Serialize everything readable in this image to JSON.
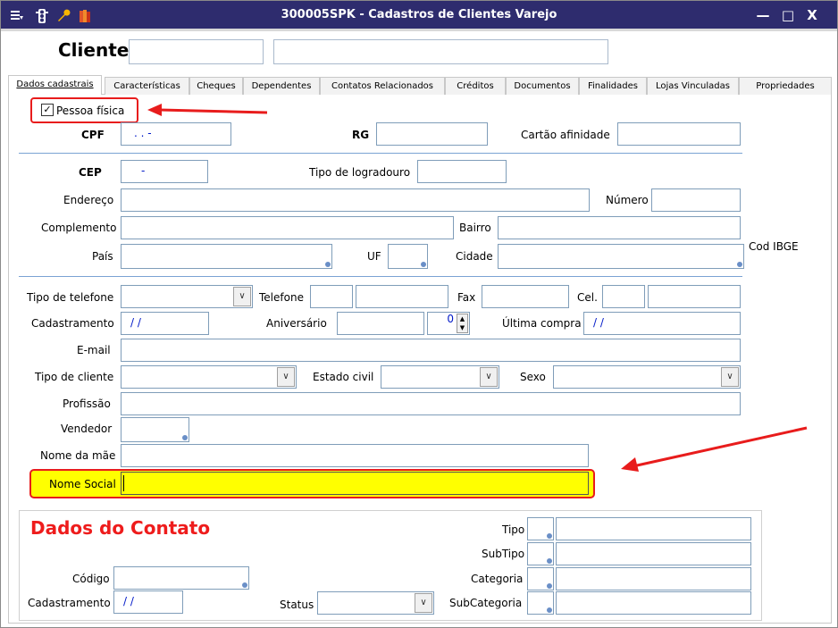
{
  "window": {
    "title": "300005SPK - Cadastros de Clientes Varejo",
    "controls": {
      "minimize": "—",
      "maximize": "□",
      "close": "X"
    }
  },
  "header": {
    "cliente_label": "Cliente",
    "cliente_code": "",
    "cliente_name": ""
  },
  "tabs": [
    {
      "label": "Dados cadastrais"
    },
    {
      "label": "Características"
    },
    {
      "label": "Cheques"
    },
    {
      "label": "Dependentes"
    },
    {
      "label": "Contatos Relacionados"
    },
    {
      "label": "Créditos"
    },
    {
      "label": "Documentos"
    },
    {
      "label": "Finalidades"
    },
    {
      "label": "Lojas Vinculadas"
    },
    {
      "label": "Propriedades"
    }
  ],
  "form": {
    "pessoa_fisica_label": "Pessoa física",
    "pessoa_fisica_checked": "✓",
    "cpf_label": "CPF",
    "cpf_value": ".   .   -",
    "rg_label": "RG",
    "cartao_label": "Cartão afinidade",
    "cep_label": "CEP",
    "cep_value": "-",
    "tipo_logradouro_label": "Tipo de logradouro",
    "endereco_label": "Endereço",
    "numero_label": "Número",
    "complemento_label": "Complemento",
    "bairro_label": "Bairro",
    "pais_label": "País",
    "uf_label": "UF",
    "cidade_label": "Cidade",
    "cod_ibge_label": "Cod IBGE",
    "tipo_telefone_label": "Tipo de telefone",
    "telefone_label": "Telefone",
    "fax_label": "Fax",
    "cel_label": "Cel.",
    "cadastramento_label": "Cadastramento",
    "cadastramento_value": "/ /",
    "aniversario_label": "Aniversário",
    "aniversario_spin_value": "0",
    "ultima_compra_label": "Última compra",
    "ultima_compra_value": "/ /",
    "email_label": "E-mail",
    "tipo_cliente_label": "Tipo de cliente",
    "estado_civil_label": "Estado civil",
    "sexo_label": "Sexo",
    "profissao_label": "Profissão",
    "vendedor_label": "Vendedor",
    "nome_mae_label": "Nome da mãe",
    "nome_social_label": "Nome Social"
  },
  "contato": {
    "title": "Dados do Contato",
    "tipo_label": "Tipo",
    "subtipo_label": "SubTipo",
    "categoria_label": "Categoria",
    "subcategoria_label": "SubCategoria",
    "codigo_label": "Código",
    "cadastramento_label": "Cadastramento",
    "cadastramento_value": "/ /",
    "status_label": "Status"
  },
  "colors": {
    "titlebar": "#2e2c6e",
    "highlight": "#ffff00",
    "annotation": "#e81c1c"
  }
}
